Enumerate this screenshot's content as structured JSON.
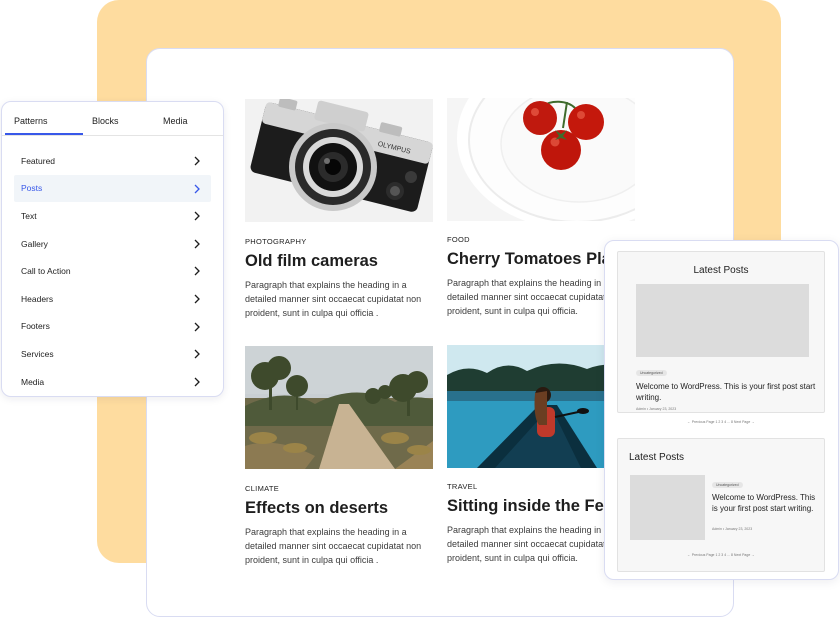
{
  "sidebar": {
    "tabs": [
      "Patterns",
      "Blocks",
      "Media"
    ],
    "active_tab": "Patterns",
    "items": [
      {
        "label": "Featured",
        "active": false
      },
      {
        "label": "Posts",
        "active": true
      },
      {
        "label": "Text",
        "active": false
      },
      {
        "label": "Gallery",
        "active": false
      },
      {
        "label": "Call to Action",
        "active": false
      },
      {
        "label": "Headers",
        "active": false
      },
      {
        "label": "Footers",
        "active": false
      },
      {
        "label": "Services",
        "active": false
      },
      {
        "label": "Media",
        "active": false
      }
    ]
  },
  "posts": [
    {
      "category": "PHOTOGRAPHY",
      "title": "Old film cameras",
      "excerpt": "Paragraph that explains the heading in a detailed manner sint occaecat cupidatat non proident, sunt in culpa qui officia .",
      "image": "camera-photo"
    },
    {
      "category": "FOOD",
      "title": "Cherry Tomatoes Plat",
      "excerpt": "Paragraph that explains the heading in a detailed manner sint occaecat cupidatat non proident, sunt in culpa qui officia.",
      "image": "tomatoes-photo"
    },
    {
      "category": "CLIMATE",
      "title": "Effects on deserts",
      "excerpt": "Paragraph that explains the heading in a detailed manner sint occaecat cupidatat non proident, sunt in culpa qui officia .",
      "image": "desert-road-photo"
    },
    {
      "category": "TRAVEL",
      "title": "Sitting inside the Ferr",
      "excerpt": "Paragraph that explains the heading in a detailed manner sint occaecat cupidatat non proident, sunt in culpa qui officia.",
      "image": "lake-boat-photo"
    }
  ],
  "latest_posts": [
    {
      "heading": "Latest Posts",
      "tag": "Uncategorized",
      "post_title": "Welcome to WordPress. This is your first post start writing.",
      "meta": "Admin • January 23, 2023",
      "pager": "← Previous Page  1 2 3 4 ... 8  Next Page →"
    },
    {
      "heading": "Latest Posts",
      "tag": "Uncategorized",
      "post_title": "Welcome to WordPress. This is your first post start writing.",
      "meta": "Admin • January 23, 2023",
      "pager": "← Previous Page  1 2 3 4 ... 8  Next Page →"
    }
  ],
  "colors": {
    "background_shape": "#fedc9f",
    "accent": "#3858e9",
    "active_item_bg": "#f1f5f9"
  }
}
